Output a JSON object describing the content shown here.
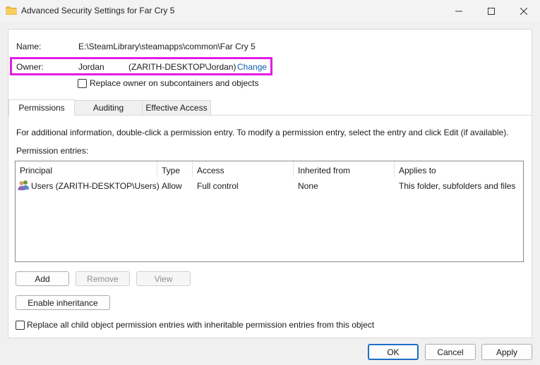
{
  "window": {
    "title": "Advanced Security Settings for Far Cry 5",
    "controls": [
      "minimize-icon",
      "maximize-icon",
      "close-icon"
    ]
  },
  "object": {
    "name_label": "Name:",
    "name_value": "E:\\SteamLibrary\\steamapps\\common\\Far Cry 5",
    "owner_label": "Owner:",
    "owner_name": "Jordan",
    "owner_account": "(ZARITH-DESKTOP\\Jordan)",
    "change_link": "Change",
    "replace_owner_checkbox": "Replace owner on subcontainers and objects",
    "replace_owner_checked": false
  },
  "tabs": [
    {
      "label": "Permissions",
      "active": true
    },
    {
      "label": "Auditing",
      "active": false
    },
    {
      "label": "Effective Access",
      "active": false
    }
  ],
  "permissions": {
    "info_text": "For additional information, double-click a permission entry. To modify a permission entry, select the entry and click Edit (if available).",
    "entries_label": "Permission entries:",
    "columns": [
      "Principal",
      "Type",
      "Access",
      "Inherited from",
      "Applies to"
    ],
    "rows": [
      {
        "icon": "users-group-icon",
        "principal": "Users (ZARITH-DESKTOP\\Users)",
        "type": "Allow",
        "access": "Full control",
        "inherited_from": "None",
        "applies_to": "This folder, subfolders and files"
      }
    ]
  },
  "buttons": {
    "add": "Add",
    "remove": "Remove",
    "view": "View",
    "enable_inheritance": "Enable inheritance",
    "ok": "OK",
    "cancel": "Cancel",
    "apply": "Apply"
  },
  "replace_child_checkbox": "Replace all child object permission entries with inheritable permission entries from this object",
  "replace_child_checked": false,
  "colors": {
    "highlight": "#e41be4",
    "link": "#0a5fb4",
    "default_button_border": "#1f6fc2"
  }
}
